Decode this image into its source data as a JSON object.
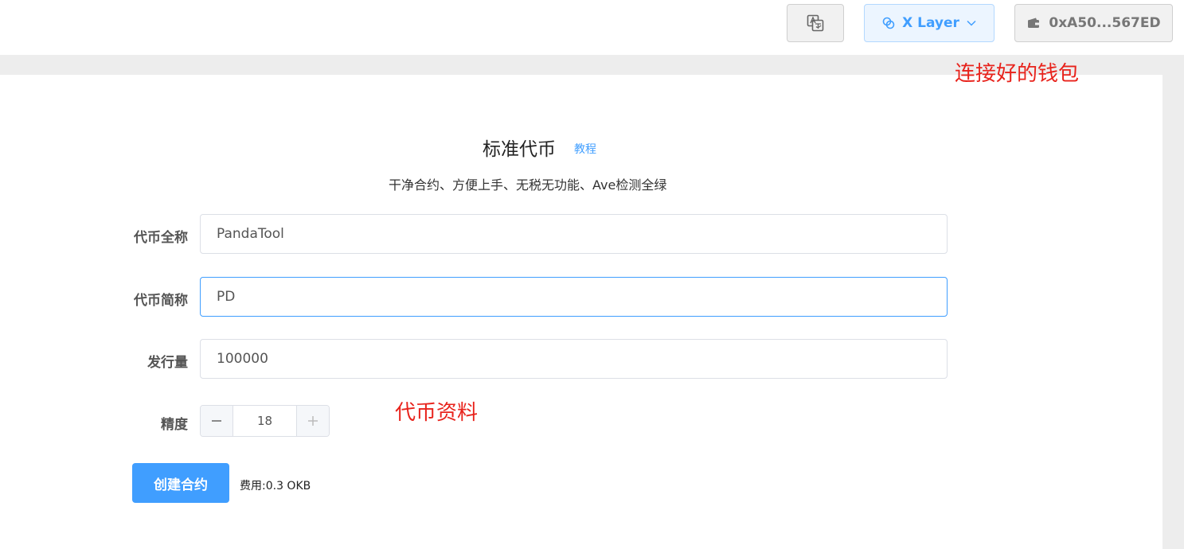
{
  "header": {
    "chain_label": "X Layer",
    "wallet_address": "0xA50...567ED"
  },
  "annotations": {
    "wallet_note": "连接好的钱包",
    "form_note": "代币资料"
  },
  "page": {
    "title": "标准代币",
    "tutorial_link": "教程",
    "subtitle": "干净合约、方便上手、无税无功能、Ave检测全绿"
  },
  "form": {
    "name_label": "代币全称",
    "name_value": "PandaTool",
    "symbol_label": "代币简称",
    "symbol_value": "PD",
    "supply_label": "发行量",
    "supply_value": "100000",
    "decimals_label": "精度",
    "decimals_value": "18"
  },
  "actions": {
    "create_label": "创建合约",
    "fee_text": "费用:0.3 OKB"
  },
  "colors": {
    "accent": "#409eff",
    "annotation": "#e8231c"
  }
}
